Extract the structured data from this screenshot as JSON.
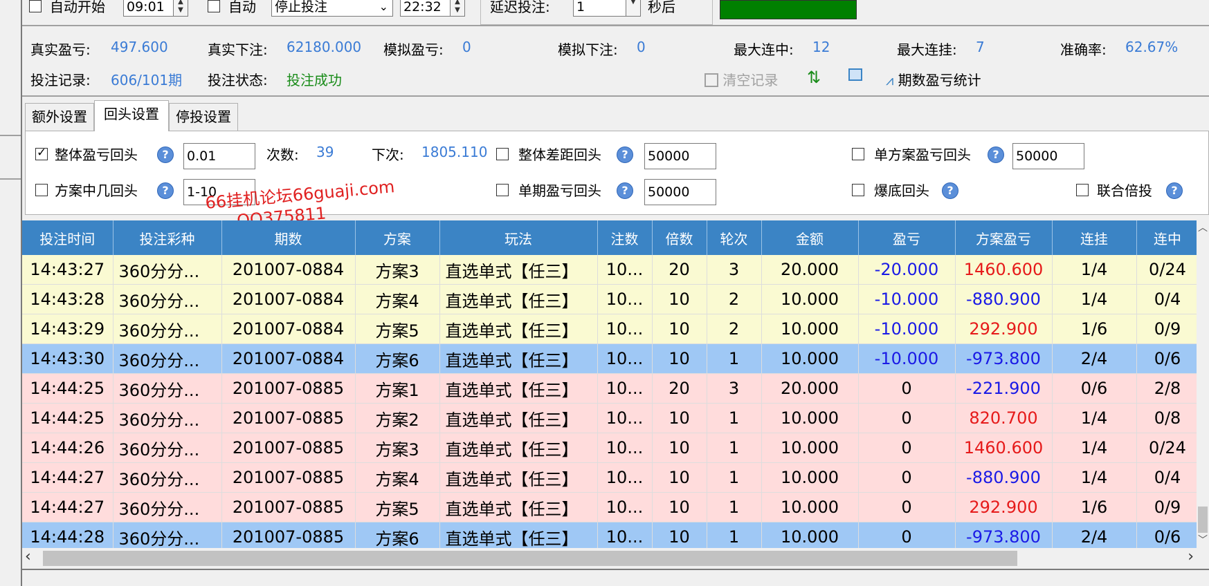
{
  "top": {
    "auto_start_label": "自动开始",
    "start_time": "09:01",
    "auto_label": "自动",
    "stop_mode": "停止投注",
    "stop_time": "22:32",
    "delay_label": "延迟投注:",
    "delay_value": "1",
    "delay_unit": "秒后",
    "status_color": "#008000"
  },
  "stats": {
    "real_pnl_label": "真实盈亏:",
    "real_pnl": "497.600",
    "real_bet_label": "真实下注:",
    "real_bet": "62180.000",
    "sim_pnl_label": "模拟盈亏:",
    "sim_pnl": "0",
    "sim_bet_label": "模拟下注:",
    "sim_bet": "0",
    "max_win_streak_label": "最大连中:",
    "max_win_streak": "12",
    "max_loss_streak_label": "最大连挂:",
    "max_loss_streak": "7",
    "accuracy_label": "准确率:",
    "accuracy": "62.67%",
    "record_label": "投注记录:",
    "record": "606/101期",
    "state_label": "投注状态:",
    "state": "投注成功",
    "clear_label": "清空记录",
    "period_stats_label": "期数盈亏统计"
  },
  "tabs": [
    {
      "label": "额外设置"
    },
    {
      "label": "回头设置"
    },
    {
      "label": "停投设置"
    }
  ],
  "settings": {
    "overall_pnl_label": "整体盈亏回头",
    "overall_pnl_value": "0.01",
    "count_label": "次数:",
    "count_value": "39",
    "next_label": "下次:",
    "next_value": "1805.110",
    "overall_gap_label": "整体差距回头",
    "overall_gap_value": "50000",
    "single_plan_label": "单方案盈亏回头",
    "single_plan_value": "50000",
    "plan_hit_label": "方案中几回头",
    "plan_hit_value": "1-10",
    "single_period_label": "单期盈亏回头",
    "single_period_value": "50000",
    "bust_label": "爆底回头",
    "joint_label": "联合倍投"
  },
  "watermark": {
    "line1": "66挂机论坛66guaji.com",
    "line2": "QQ375811"
  },
  "table": {
    "columns": [
      "投注时间",
      "投注彩种",
      "期数",
      "方案",
      "玩法",
      "注数",
      "倍数",
      "轮次",
      "金额",
      "盈亏",
      "方案盈亏",
      "连挂",
      "连中"
    ],
    "rows": [
      {
        "style": "y",
        "cells": [
          "14:43:27",
          "360分分...",
          "201007-0884",
          "方案3",
          "直选单式【任三】",
          "10...",
          "20",
          "3",
          "20.000",
          "-20.000",
          "1460.600",
          "1/4",
          "0/24"
        ],
        "pnl_sign": "neg",
        "plan_sign": "pos"
      },
      {
        "style": "y",
        "cells": [
          "14:43:28",
          "360分分...",
          "201007-0884",
          "方案4",
          "直选单式【任三】",
          "10...",
          "10",
          "2",
          "10.000",
          "-10.000",
          "-880.900",
          "1/4",
          "0/4"
        ],
        "pnl_sign": "neg",
        "plan_sign": "neg"
      },
      {
        "style": "y",
        "cells": [
          "14:43:29",
          "360分分...",
          "201007-0884",
          "方案5",
          "直选单式【任三】",
          "10...",
          "10",
          "2",
          "10.000",
          "-10.000",
          "292.900",
          "1/6",
          "0/9"
        ],
        "pnl_sign": "neg",
        "plan_sign": "pos"
      },
      {
        "style": "b",
        "cells": [
          "14:43:30",
          "360分分...",
          "201007-0884",
          "方案6",
          "直选单式【任三】",
          "10...",
          "10",
          "1",
          "10.000",
          "-10.000",
          "-973.800",
          "2/4",
          "0/6"
        ],
        "pnl_sign": "neg",
        "plan_sign": "neg"
      },
      {
        "style": "p",
        "cells": [
          "14:44:25",
          "360分分...",
          "201007-0885",
          "方案1",
          "直选单式【任三】",
          "10...",
          "20",
          "3",
          "20.000",
          "0",
          "-221.900",
          "0/6",
          "2/8"
        ],
        "pnl_sign": "",
        "plan_sign": "neg"
      },
      {
        "style": "p",
        "cells": [
          "14:44:25",
          "360分分...",
          "201007-0885",
          "方案2",
          "直选单式【任三】",
          "10...",
          "10",
          "1",
          "10.000",
          "0",
          "820.700",
          "1/4",
          "0/8"
        ],
        "pnl_sign": "",
        "plan_sign": "pos"
      },
      {
        "style": "p",
        "cells": [
          "14:44:26",
          "360分分...",
          "201007-0885",
          "方案3",
          "直选单式【任三】",
          "10...",
          "10",
          "1",
          "10.000",
          "0",
          "1460.600",
          "1/4",
          "0/24"
        ],
        "pnl_sign": "",
        "plan_sign": "pos"
      },
      {
        "style": "p",
        "cells": [
          "14:44:27",
          "360分分...",
          "201007-0885",
          "方案4",
          "直选单式【任三】",
          "10...",
          "10",
          "1",
          "10.000",
          "0",
          "-880.900",
          "1/4",
          "0/4"
        ],
        "pnl_sign": "",
        "plan_sign": "neg"
      },
      {
        "style": "p",
        "cells": [
          "14:44:27",
          "360分分...",
          "201007-0885",
          "方案5",
          "直选单式【任三】",
          "10...",
          "10",
          "1",
          "10.000",
          "0",
          "292.900",
          "1/6",
          "0/9"
        ],
        "pnl_sign": "",
        "plan_sign": "pos"
      },
      {
        "style": "b",
        "cells": [
          "14:44:28",
          "360分分...",
          "201007-0885",
          "方案6",
          "直选单式【任三】",
          "10...",
          "10",
          "1",
          "10.000",
          "0",
          "-973.800",
          "2/4",
          "0/6"
        ],
        "pnl_sign": "",
        "plan_sign": "neg"
      }
    ]
  }
}
